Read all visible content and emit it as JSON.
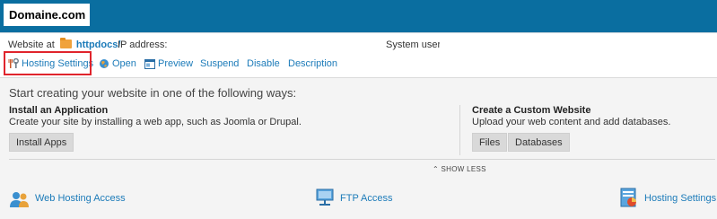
{
  "header": {
    "logo_text": "Domaine.com",
    "bar_color": "#0a6ea0"
  },
  "subheader": {
    "website_at_label": "Website at",
    "folder_link": "httpdocs/",
    "ip_label": "IP address:",
    "system_user_label": "System user:"
  },
  "actions": [
    {
      "label": "Hosting Settings",
      "icon": "wrench-fork-icon",
      "highlighted": true
    },
    {
      "label": "Open",
      "icon": "globe-icon"
    },
    {
      "label": "Preview",
      "icon": "preview-icon"
    },
    {
      "label": "Suspend"
    },
    {
      "label": "Disable"
    },
    {
      "label": "Description"
    }
  ],
  "panel": {
    "intro": "Start creating your website in one of the following ways:",
    "install_title": "Install an Application",
    "install_text": "Create your site by installing a web app, such as Joomla or Drupal.",
    "install_button": "Install Apps",
    "custom_title": "Create a Custom Website",
    "custom_text": "Upload your web content and add databases.",
    "files_button": "Files",
    "databases_button": "Databases",
    "show_less": "SHOW LESS"
  },
  "bottom_links": [
    {
      "label": "Web Hosting Access",
      "icon": "users-icon"
    },
    {
      "label": "FTP Access",
      "icon": "ftp-monitor-icon"
    },
    {
      "label": "Hosting Settings",
      "icon": "hosting-settings-icon"
    }
  ],
  "colors": {
    "link": "#1c7bb9",
    "highlight_border": "#e0242c"
  }
}
